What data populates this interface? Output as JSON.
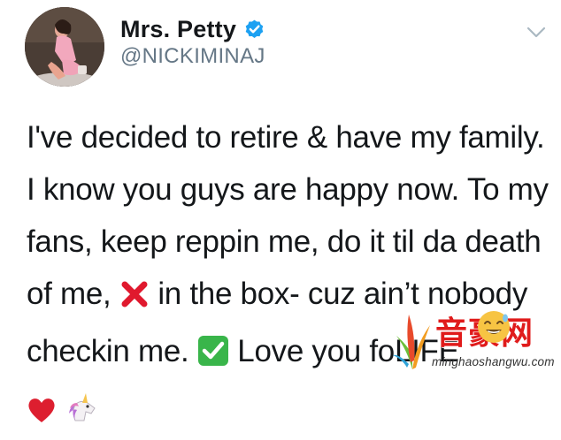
{
  "tweet": {
    "display_name": "Mrs. Petty",
    "handle": "@NICKIMINAJ",
    "verified": true,
    "lines": [
      {
        "text": "I've decided to retire & have my family."
      },
      {
        "text": "I know you guys are happy now. To my"
      },
      {
        "text": "fans, keep reppin me, do it til da death"
      },
      {
        "before": "of me, ",
        "after": " in the box- cuz ain’t nobody"
      },
      {
        "before": "checkin me. ",
        "after": " Love you fo",
        "tail": "LIFE"
      }
    ],
    "icons": {
      "menu": "chevron-down-icon",
      "verified": "verified-badge-icon",
      "cross": "cross-mark-emoji",
      "check": "check-mark-emoji",
      "heart": "red-heart-emoji",
      "unicorn": "unicorn-emoji",
      "grin": "smiling-face-emoji"
    },
    "colors": {
      "text": "#14171a",
      "secondary": "#657786",
      "verified_blue": "#1da1f2",
      "cross_red": "#e0192e",
      "check_green": "#39b54a",
      "heart_red": "#dd1e2f"
    }
  },
  "watermark": {
    "title": "音豪网",
    "url": "minghaoshangwu.com"
  }
}
